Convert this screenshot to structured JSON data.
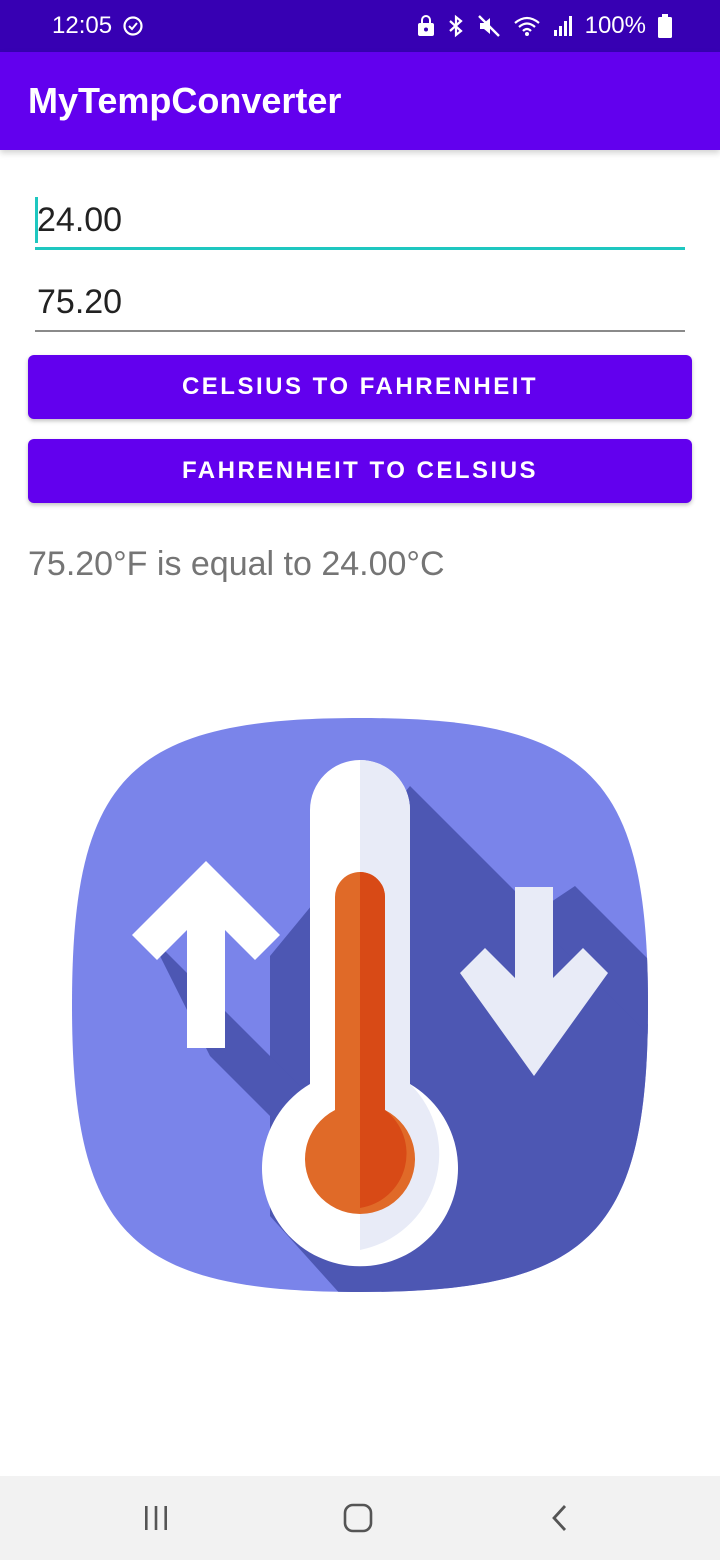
{
  "status_bar": {
    "time": "12:05",
    "battery_percent": "100%"
  },
  "app_bar": {
    "title": "MyTempConverter"
  },
  "inputs": {
    "celsius_value": "24.00",
    "fahrenheit_value": "75.20"
  },
  "buttons": {
    "c_to_f": "CELSIUS TO FAHRENHEIT",
    "f_to_c": "FAHRENHEIT TO CELSIUS"
  },
  "result_text": "75.20°F is equal to 24.00°C",
  "colors": {
    "status_bar": "#3700b3",
    "primary": "#6200ee",
    "accent": "#1ec7c0",
    "icon_background": "#7a84ea",
    "icon_shadow": "#4d57b3",
    "thermometer_fluid": "#d84a16"
  },
  "icons": {
    "status": [
      "sync-icon",
      "lock-icon",
      "bluetooth-icon",
      "mute-icon",
      "wifi-icon",
      "signal-icon",
      "battery-icon"
    ],
    "image": "thermometer-converter-icon",
    "nav": [
      "recent-apps-icon",
      "home-icon",
      "back-icon"
    ]
  }
}
